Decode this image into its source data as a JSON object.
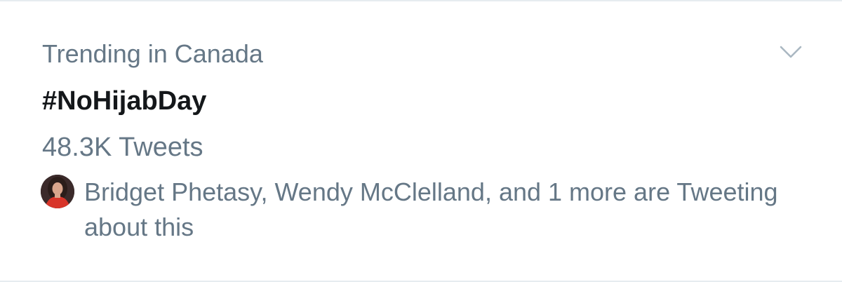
{
  "trend": {
    "context": "Trending in Canada",
    "topic": "#NoHijabDay",
    "tweet_count": "48.3K Tweets",
    "social_proof": "Bridget Phetasy, Wendy McClelland, and 1 more are Tweeting about this"
  },
  "icons": {
    "menu": "chevron-down-icon",
    "avatar": "user-avatar"
  },
  "colors": {
    "secondary_text": "#657786",
    "primary_text": "#14171a",
    "divider": "#e6ecf0"
  }
}
